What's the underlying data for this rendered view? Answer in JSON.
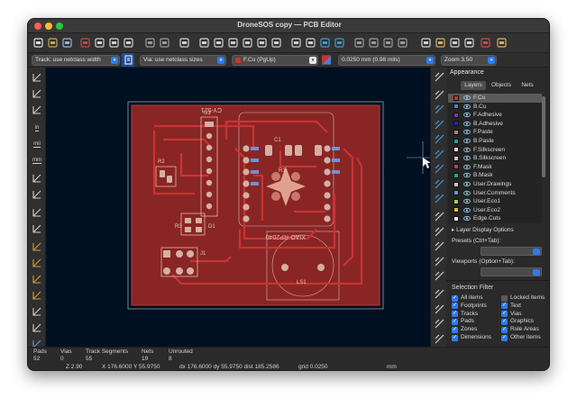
{
  "window": {
    "title": "DroneSOS copy — PCB Editor"
  },
  "toolbar_icons": [
    "new-board-icon",
    "open-icon",
    "save-icon",
    "board-setup-icon",
    "page-settings-icon",
    "print-icon",
    "plot-icon",
    "undo-icon",
    "redo-icon",
    "find-icon",
    "refresh-icon",
    "zoom-in-icon",
    "zoom-out-icon",
    "zoom-fit-icon",
    "zoom-objects-icon",
    "zoom-selection-icon",
    "rotate-ccw-icon",
    "rotate-cw-icon",
    "flip-icon",
    "mirror-icon",
    "group-icon",
    "ungroup-icon",
    "lock-icon",
    "unlock-icon",
    "netlist-icon",
    "footprint-library-icon",
    "footprint-editor-icon",
    "3d-viewer-icon",
    "drc-icon",
    "scripting-icon"
  ],
  "options": {
    "track": "Track: use netclass width",
    "via": "Via: use netclass sizes",
    "layer": "F.Cu (PgUp)",
    "grid": "0.0250 mm (0.98 mils)",
    "zoom": "Zoom 3.50"
  },
  "left_tools": [
    {
      "icon": "grid-icon"
    },
    {
      "icon": "polar-coords-icon"
    },
    {
      "icon": "measure-icon"
    },
    {
      "icon": "inch-units-icon",
      "label": "in"
    },
    {
      "icon": "mil-units-icon",
      "label": "mil"
    },
    {
      "icon": "mm-units-icon",
      "label": "mm"
    },
    {
      "icon": "cursor-shape-icon"
    },
    {
      "icon": "origin-icon"
    },
    {
      "icon": "ratsnest-icon"
    },
    {
      "icon": "curved-ratsnest-icon"
    },
    {
      "icon": "zone-fill-icon"
    },
    {
      "icon": "zone-outline-icon"
    },
    {
      "icon": "pad-sketch-icon"
    },
    {
      "icon": "via-sketch-icon"
    },
    {
      "icon": "track-sketch-icon"
    },
    {
      "icon": "high-contrast-icon"
    },
    {
      "icon": "net-inspector-icon"
    }
  ],
  "right_tools": [
    "select-icon",
    "local-ratsnest-icon",
    "add-footprint-icon",
    "route-track-icon",
    "route-diff-pair-icon",
    "tune-length-icon",
    "add-via-icon",
    "add-zone-icon",
    "add-rule-area-icon",
    "draw-line-icon",
    "draw-arc-icon",
    "draw-rectangle-icon",
    "draw-circle-icon",
    "draw-polygon-icon",
    "add-image-icon",
    "add-text-icon",
    "add-dimension-icon",
    "delete-icon"
  ],
  "appearance": {
    "title": "Appearance",
    "tabs": [
      "Layers",
      "Objects",
      "Nets"
    ],
    "active_tab": "Layers",
    "layers": [
      {
        "name": "F.Cu",
        "color": "#c83434",
        "selected": true
      },
      {
        "name": "B.Cu",
        "color": "#4d7fc4",
        "selected": false
      },
      {
        "name": "F.Adhesive",
        "color": "#8b31a3",
        "selected": false
      },
      {
        "name": "B.Adhesive",
        "color": "#2a1ec6",
        "selected": false
      },
      {
        "name": "F.Paste",
        "color": "#b97a7a",
        "selected": false
      },
      {
        "name": "B.Paste",
        "color": "#16a6a6",
        "selected": false
      },
      {
        "name": "F.Silkscreen",
        "color": "#e8e0c4",
        "selected": false
      },
      {
        "name": "B.Silkscreen",
        "color": "#e8b4c4",
        "selected": false
      },
      {
        "name": "F.Mask",
        "color": "#c0367c",
        "selected": false
      },
      {
        "name": "B.Mask",
        "color": "#1ab37a",
        "selected": false
      },
      {
        "name": "User.Drawings",
        "color": "#c2c8cf",
        "selected": false
      },
      {
        "name": "User.Comments",
        "color": "#6c93d4",
        "selected": false
      },
      {
        "name": "User.Eco1",
        "color": "#a6cc5a",
        "selected": false
      },
      {
        "name": "User.Eco2",
        "color": "#d8c23c",
        "selected": false
      },
      {
        "name": "Edge.Cuts",
        "color": "#e8e8e8",
        "selected": false
      }
    ],
    "layer_display_options": "Layer Display Options",
    "presets_label": "Presets (Ctrl+Tab):",
    "viewports_label": "Viewports (Option+Tab):"
  },
  "selection_filter": {
    "title": "Selection Filter",
    "items": [
      {
        "label": "All items",
        "checked": true
      },
      {
        "label": "Locked items",
        "checked": false
      },
      {
        "label": "Footprints",
        "checked": true
      },
      {
        "label": "Text",
        "checked": true
      },
      {
        "label": "Tracks",
        "checked": true
      },
      {
        "label": "Vias",
        "checked": true
      },
      {
        "label": "Pads",
        "checked": true
      },
      {
        "label": "Graphics",
        "checked": true
      },
      {
        "label": "Zones",
        "checked": true
      },
      {
        "label": "Rule Areas",
        "checked": true
      },
      {
        "label": "Dimensions",
        "checked": true
      },
      {
        "label": "Other items",
        "checked": true
      }
    ]
  },
  "status": {
    "pads_label": "Pads",
    "pads_value": "52",
    "vias_label": "Vias",
    "vias_value": "0",
    "segments_label": "Track Segments",
    "segments_value": "55",
    "nets_label": "Nets",
    "nets_value": "19",
    "unrouted_label": "Unrouted",
    "unrouted_value": "8",
    "zoom": "Z 2.90",
    "cursor": "X 176.6000  Y 55.9750",
    "delta": "dx 176.6000  dy 55.9750  dist 185.2586",
    "grid": "grid 0.0250",
    "units": "mm"
  },
  "silkscreen": {
    "r2": "R2",
    "u1": "U1",
    "r1": "R1",
    "c1": "C1",
    "r3": "R3",
    "d1": "D1",
    "j1": "J1",
    "ref_top": "CY-521",
    "ref_mid": "XIAO-RP2040",
    "ls1": "LS1"
  },
  "colors": {
    "copper": "#8a2525",
    "track": "#c83434",
    "pad": "#d4b0a4",
    "silk": "#e8c8b4",
    "background": "#001023",
    "accent": "#2d7bf0"
  }
}
